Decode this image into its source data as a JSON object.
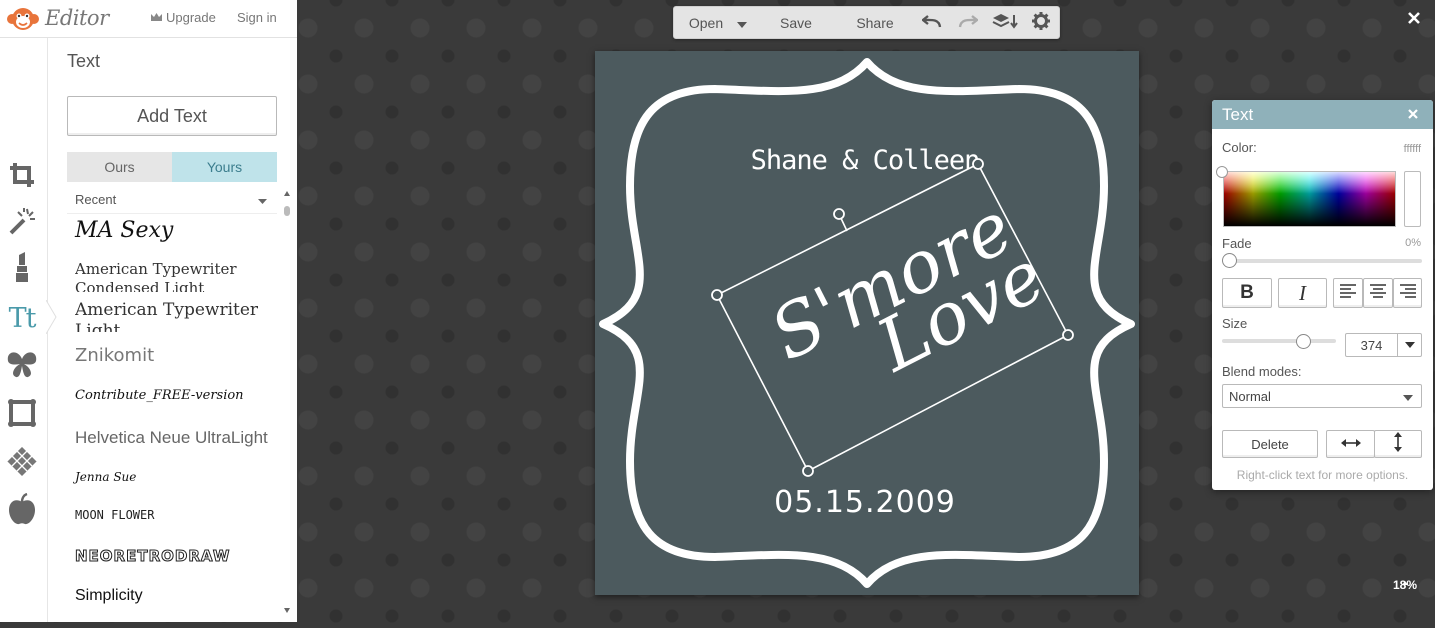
{
  "app": {
    "brand": "Editor",
    "upgrade_label": "Upgrade",
    "signin_label": "Sign in"
  },
  "toolrail": {
    "tools": [
      {
        "icon": "crop-icon"
      },
      {
        "icon": "magic-wand-icon"
      },
      {
        "icon": "lipstick-icon"
      },
      {
        "icon": "text-tool-icon",
        "label": "Tt",
        "active": true
      },
      {
        "icon": "butterfly-icon"
      },
      {
        "icon": "frame-icon"
      },
      {
        "icon": "texture-icon"
      },
      {
        "icon": "apple-icon"
      }
    ]
  },
  "text_panel": {
    "title": "Text",
    "add_text_label": "Add Text",
    "tabs": [
      {
        "label": "Ours",
        "active": false
      },
      {
        "label": "Yours",
        "active": true
      }
    ],
    "filter": "Recent",
    "fonts": [
      "MA Sexy",
      "American Typewriter Condensed Light",
      "American Typewriter Light",
      "Znikomit",
      "Contribute_FREE-version",
      "Helvetica Neue UltraLight",
      "Jenna Sue",
      "MOON FLOWER",
      "NEORETRODRAW",
      "Simplicity"
    ]
  },
  "toolbar": {
    "open_label": "Open",
    "save_label": "Save",
    "share_label": "Share"
  },
  "canvas": {
    "background_color": "#4c5a5e",
    "names": "Shane & Colleen",
    "date": "05.15.2009",
    "script_line1": "S'more",
    "script_line2": "Love"
  },
  "properties": {
    "title": "Text",
    "color_label": "Color:",
    "color_value": "ffffff",
    "fade_label": "Fade",
    "fade_value": "0%",
    "fade_level": 0,
    "size_label": "Size",
    "size_value": "374",
    "blend_label": "Blend modes:",
    "blend_value": "Normal",
    "delete_label": "Delete",
    "hint": "Right-click text for more options."
  },
  "zoom": "18%"
}
